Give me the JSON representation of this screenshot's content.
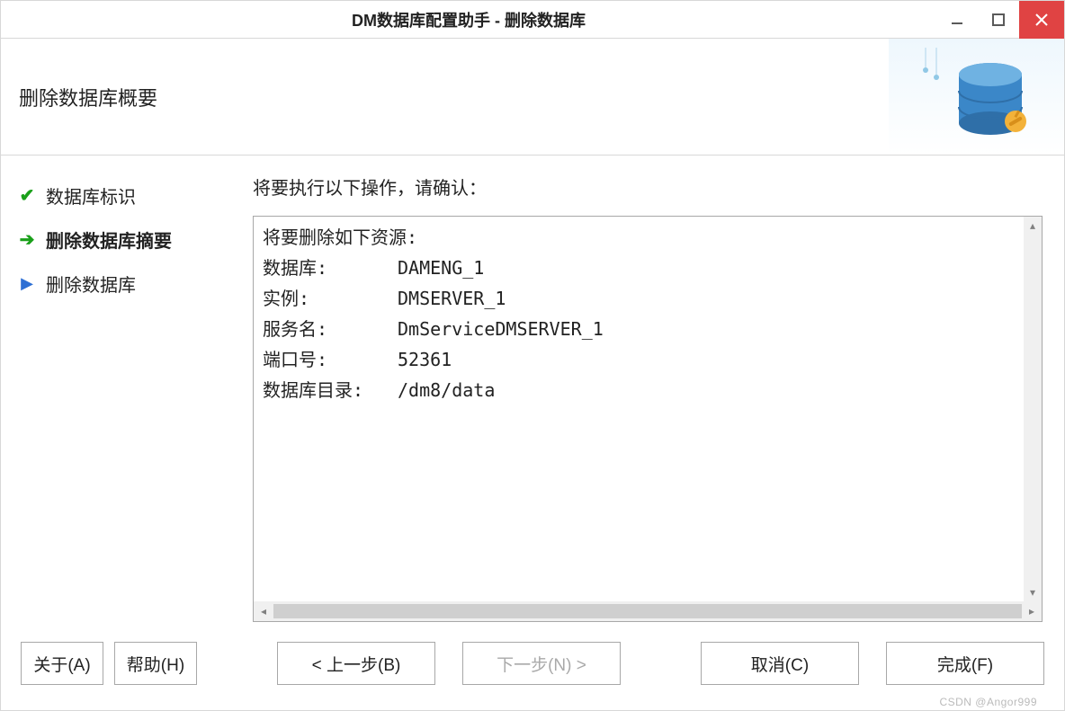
{
  "titlebar": {
    "title": "DM数据库配置助手 - 删除数据库"
  },
  "header": {
    "subtitle": "删除数据库概要"
  },
  "sidebar": {
    "items": [
      {
        "label": "数据库标识",
        "state": "done"
      },
      {
        "label": "删除数据库摘要",
        "state": "current"
      },
      {
        "label": "删除数据库",
        "state": "future"
      }
    ]
  },
  "main": {
    "instruction": "将要执行以下操作，请确认：",
    "summary": {
      "intro": "将要删除如下资源:",
      "rows": [
        {
          "label": "数据库:",
          "value": "DAMENG_1"
        },
        {
          "label": "实例:",
          "value": "DMSERVER_1"
        },
        {
          "label": "服务名:",
          "value": "DmServiceDMSERVER_1"
        },
        {
          "label": "端口号:",
          "value": "52361"
        },
        {
          "label": "数据库目录:",
          "value": "/dm8/data"
        }
      ]
    }
  },
  "footer": {
    "about": "关于(A)",
    "help": "帮助(H)",
    "back": "< 上一步(B)",
    "next": "下一步(N) >",
    "cancel": "取消(C)",
    "finish": "完成(F)"
  },
  "watermark": "CSDN @Angor999"
}
